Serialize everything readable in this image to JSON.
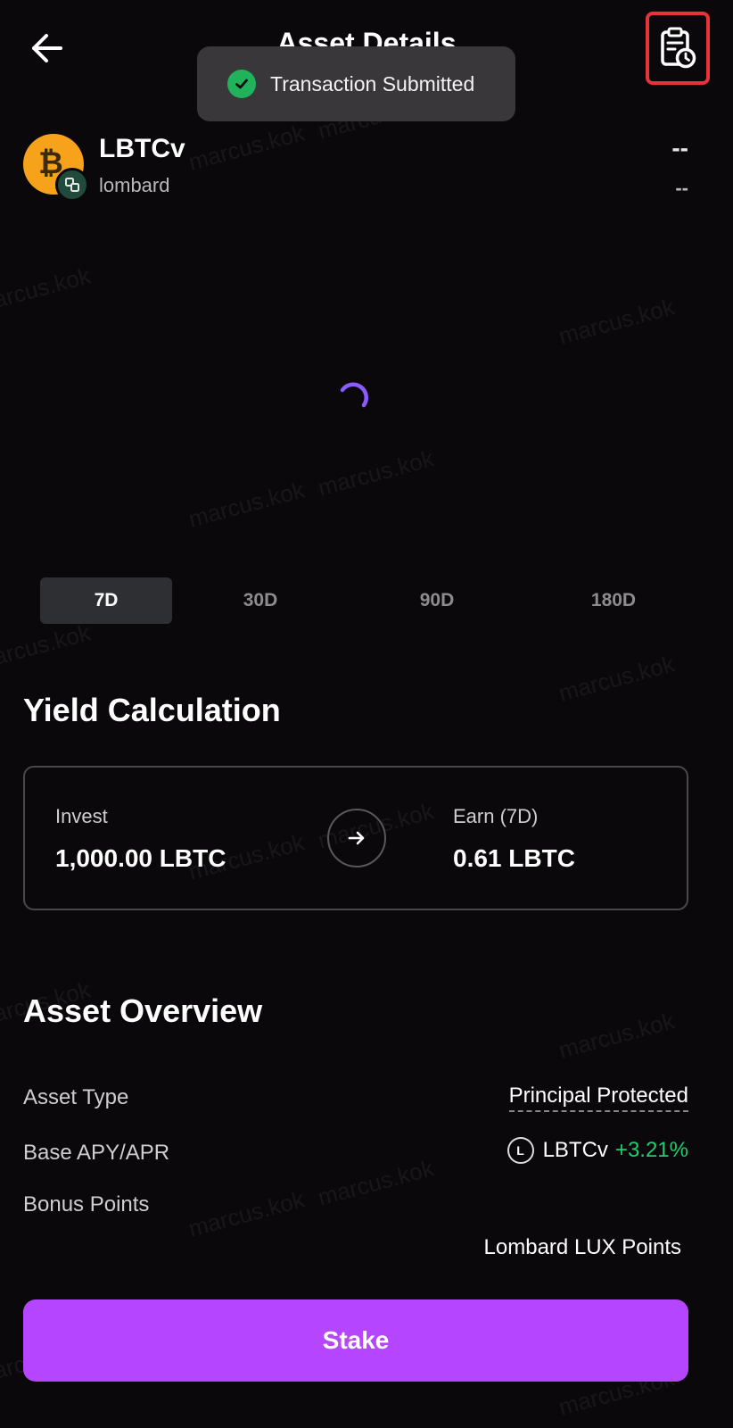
{
  "header": {
    "title": "Asset Details",
    "back_icon": "arrow-left-icon",
    "history_icon": "transaction-history-icon"
  },
  "toast": {
    "text": "Transaction Submitted",
    "icon": "check-circle-icon",
    "color": "#20b35c"
  },
  "asset": {
    "name": "LBTCv",
    "provider": "lombard",
    "price": "--",
    "change": "--",
    "logo_icon": "bitcoin-icon",
    "logo_color": "#f7a21b"
  },
  "period_tabs": [
    "7D",
    "30D",
    "90D",
    "180D"
  ],
  "period_selected": "7D",
  "yield_calculation": {
    "title": "Yield Calculation",
    "invest_label": "Invest",
    "invest_value": "1,000.00 LBTC",
    "earn_label": "Earn (7D)",
    "earn_value": "0.61 LBTC"
  },
  "asset_overview": {
    "title": "Asset Overview",
    "asset_type_label": "Asset Type",
    "asset_type_value": "Principal Protected",
    "apy_label": "Base APY/APR",
    "apy_token": "LBTCv",
    "apy_token_icon_text": "L",
    "apy_value": "+3.21%",
    "bonus_label": "Bonus Points",
    "bonus_value": "Lombard LUX Points"
  },
  "stake_button": "Stake",
  "colors": {
    "accent": "#b545ff",
    "positive": "#1fcf6d",
    "highlight_border": "#e5343c",
    "background": "#0b080b"
  },
  "watermark": "marcus.kok"
}
